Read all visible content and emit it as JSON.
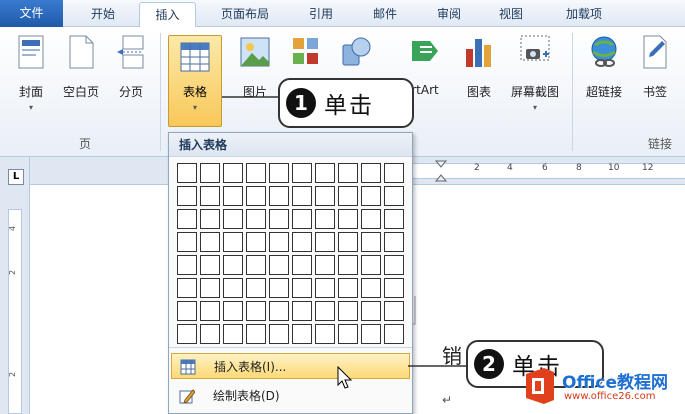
{
  "tabs": [
    {
      "label": "文件"
    },
    {
      "label": "开始"
    },
    {
      "label": "插入"
    },
    {
      "label": "页面布局"
    },
    {
      "label": "引用"
    },
    {
      "label": "邮件"
    },
    {
      "label": "审阅"
    },
    {
      "label": "视图"
    },
    {
      "label": "加载项"
    }
  ],
  "ribbon": {
    "cover": "封面",
    "blank_page": "空白页",
    "page_break": "分页",
    "table": "表格",
    "picture": "图片",
    "smartart": "rtArt",
    "chart": "图表",
    "screenshot": "屏幕截图",
    "hyperlink": "超链接",
    "bookmark": "书签",
    "group_pages": "页",
    "group_links": "链接",
    "dropdown_glyph": "▾"
  },
  "callouts": {
    "step1_num": "1",
    "step1_text": "单击",
    "step2_num": "2",
    "step2_text": "单击"
  },
  "ruler": {
    "left_box": "L",
    "ticks": [
      "2",
      "4",
      "6",
      "8",
      "10",
      "12"
    ],
    "vticks": [
      "4",
      "2",
      "2"
    ]
  },
  "dropdown": {
    "header": "插入表格",
    "grid_cols": 10,
    "grid_rows": 8,
    "insert_table": "插入表格(I)...",
    "draw_table": "绘制表格(D)"
  },
  "doc": {
    "text_fragment": "销",
    "para_mark": "↵"
  },
  "watermark": {
    "brand": "Office教程网",
    "url": "www.office26.com"
  }
}
